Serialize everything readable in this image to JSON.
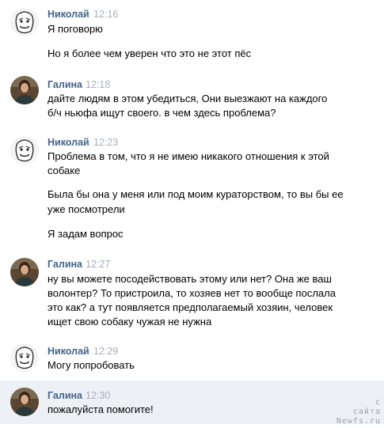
{
  "messages": [
    {
      "author": "Николай",
      "time": "12:16",
      "avatar": "nikolai-avatar",
      "lines": [
        "Я поговорю",
        "",
        "Но я более чем уверен что это не этот пёс"
      ]
    },
    {
      "author": "Галина",
      "time": "12:18",
      "avatar": "galina-avatar",
      "lines": [
        "дайте людям в этом убедиться, Они выезжают на каждого",
        "б/ч ньюфа ищут своего. в чем здесь проблема?"
      ]
    },
    {
      "author": "Николай",
      "time": "12:23",
      "avatar": "nikolai-avatar",
      "lines": [
        "Проблема в том, что я не имею никакого отношения к этой",
        "собаке",
        "",
        "Была бы она у меня или под моим кураторством, то вы бы ее",
        "уже посмотрели",
        "",
        "Я задам вопрос"
      ]
    },
    {
      "author": "Галина",
      "time": "12:27",
      "avatar": "galina-avatar",
      "lines": [
        "ну вы можете посодействовать этому или нет? Она же ваш",
        "волонтер? То пристроила, то хозяев нет то вообще послала",
        "это как? а тут появляется предполагаемый хозяин, человек",
        "ищет свою собаку чужая не нужна"
      ]
    },
    {
      "author": "Николай",
      "time": "12:29",
      "avatar": "nikolai-avatar",
      "lines": [
        "Могу попробовать"
      ]
    },
    {
      "author": "Галина",
      "time": "12:30",
      "avatar": "galina-avatar",
      "lines": [
        "пожалуйста помогите!"
      ]
    }
  ],
  "watermark": {
    "line1": "с",
    "line2": "сайта",
    "line3": "Newfs.ru"
  },
  "colors": {
    "author": "#42648b",
    "time": "#a8b0bb",
    "highlight": "#edf0f5"
  }
}
